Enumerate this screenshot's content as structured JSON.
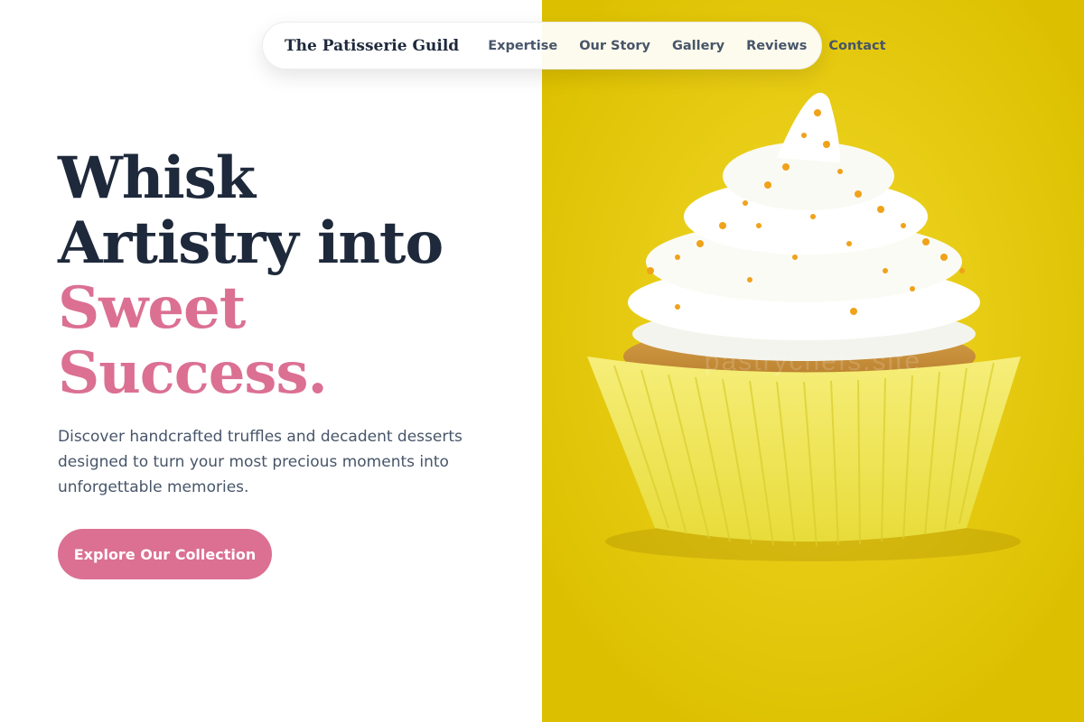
{
  "nav": {
    "brand": "The Patisserie Guild",
    "links": [
      "Expertise",
      "Our Story",
      "Gallery",
      "Reviews",
      "Contact"
    ]
  },
  "hero": {
    "headline_line1": "Whisk",
    "headline_line2": "Artistry into",
    "headline_accent_line1": "Sweet",
    "headline_accent_line2": "Success.",
    "description": "Discover handcrafted truffles and decadent desserts designed to turn your most precious moments into unforgettable memories.",
    "cta_label": "Explore Our Collection"
  },
  "photo": {
    "watermark": "pastrychefs.site"
  },
  "colors": {
    "accent_pink": "#db7093",
    "heading_dark": "#1e293b",
    "body_text": "#475569",
    "photo_background": "#e6c800"
  }
}
